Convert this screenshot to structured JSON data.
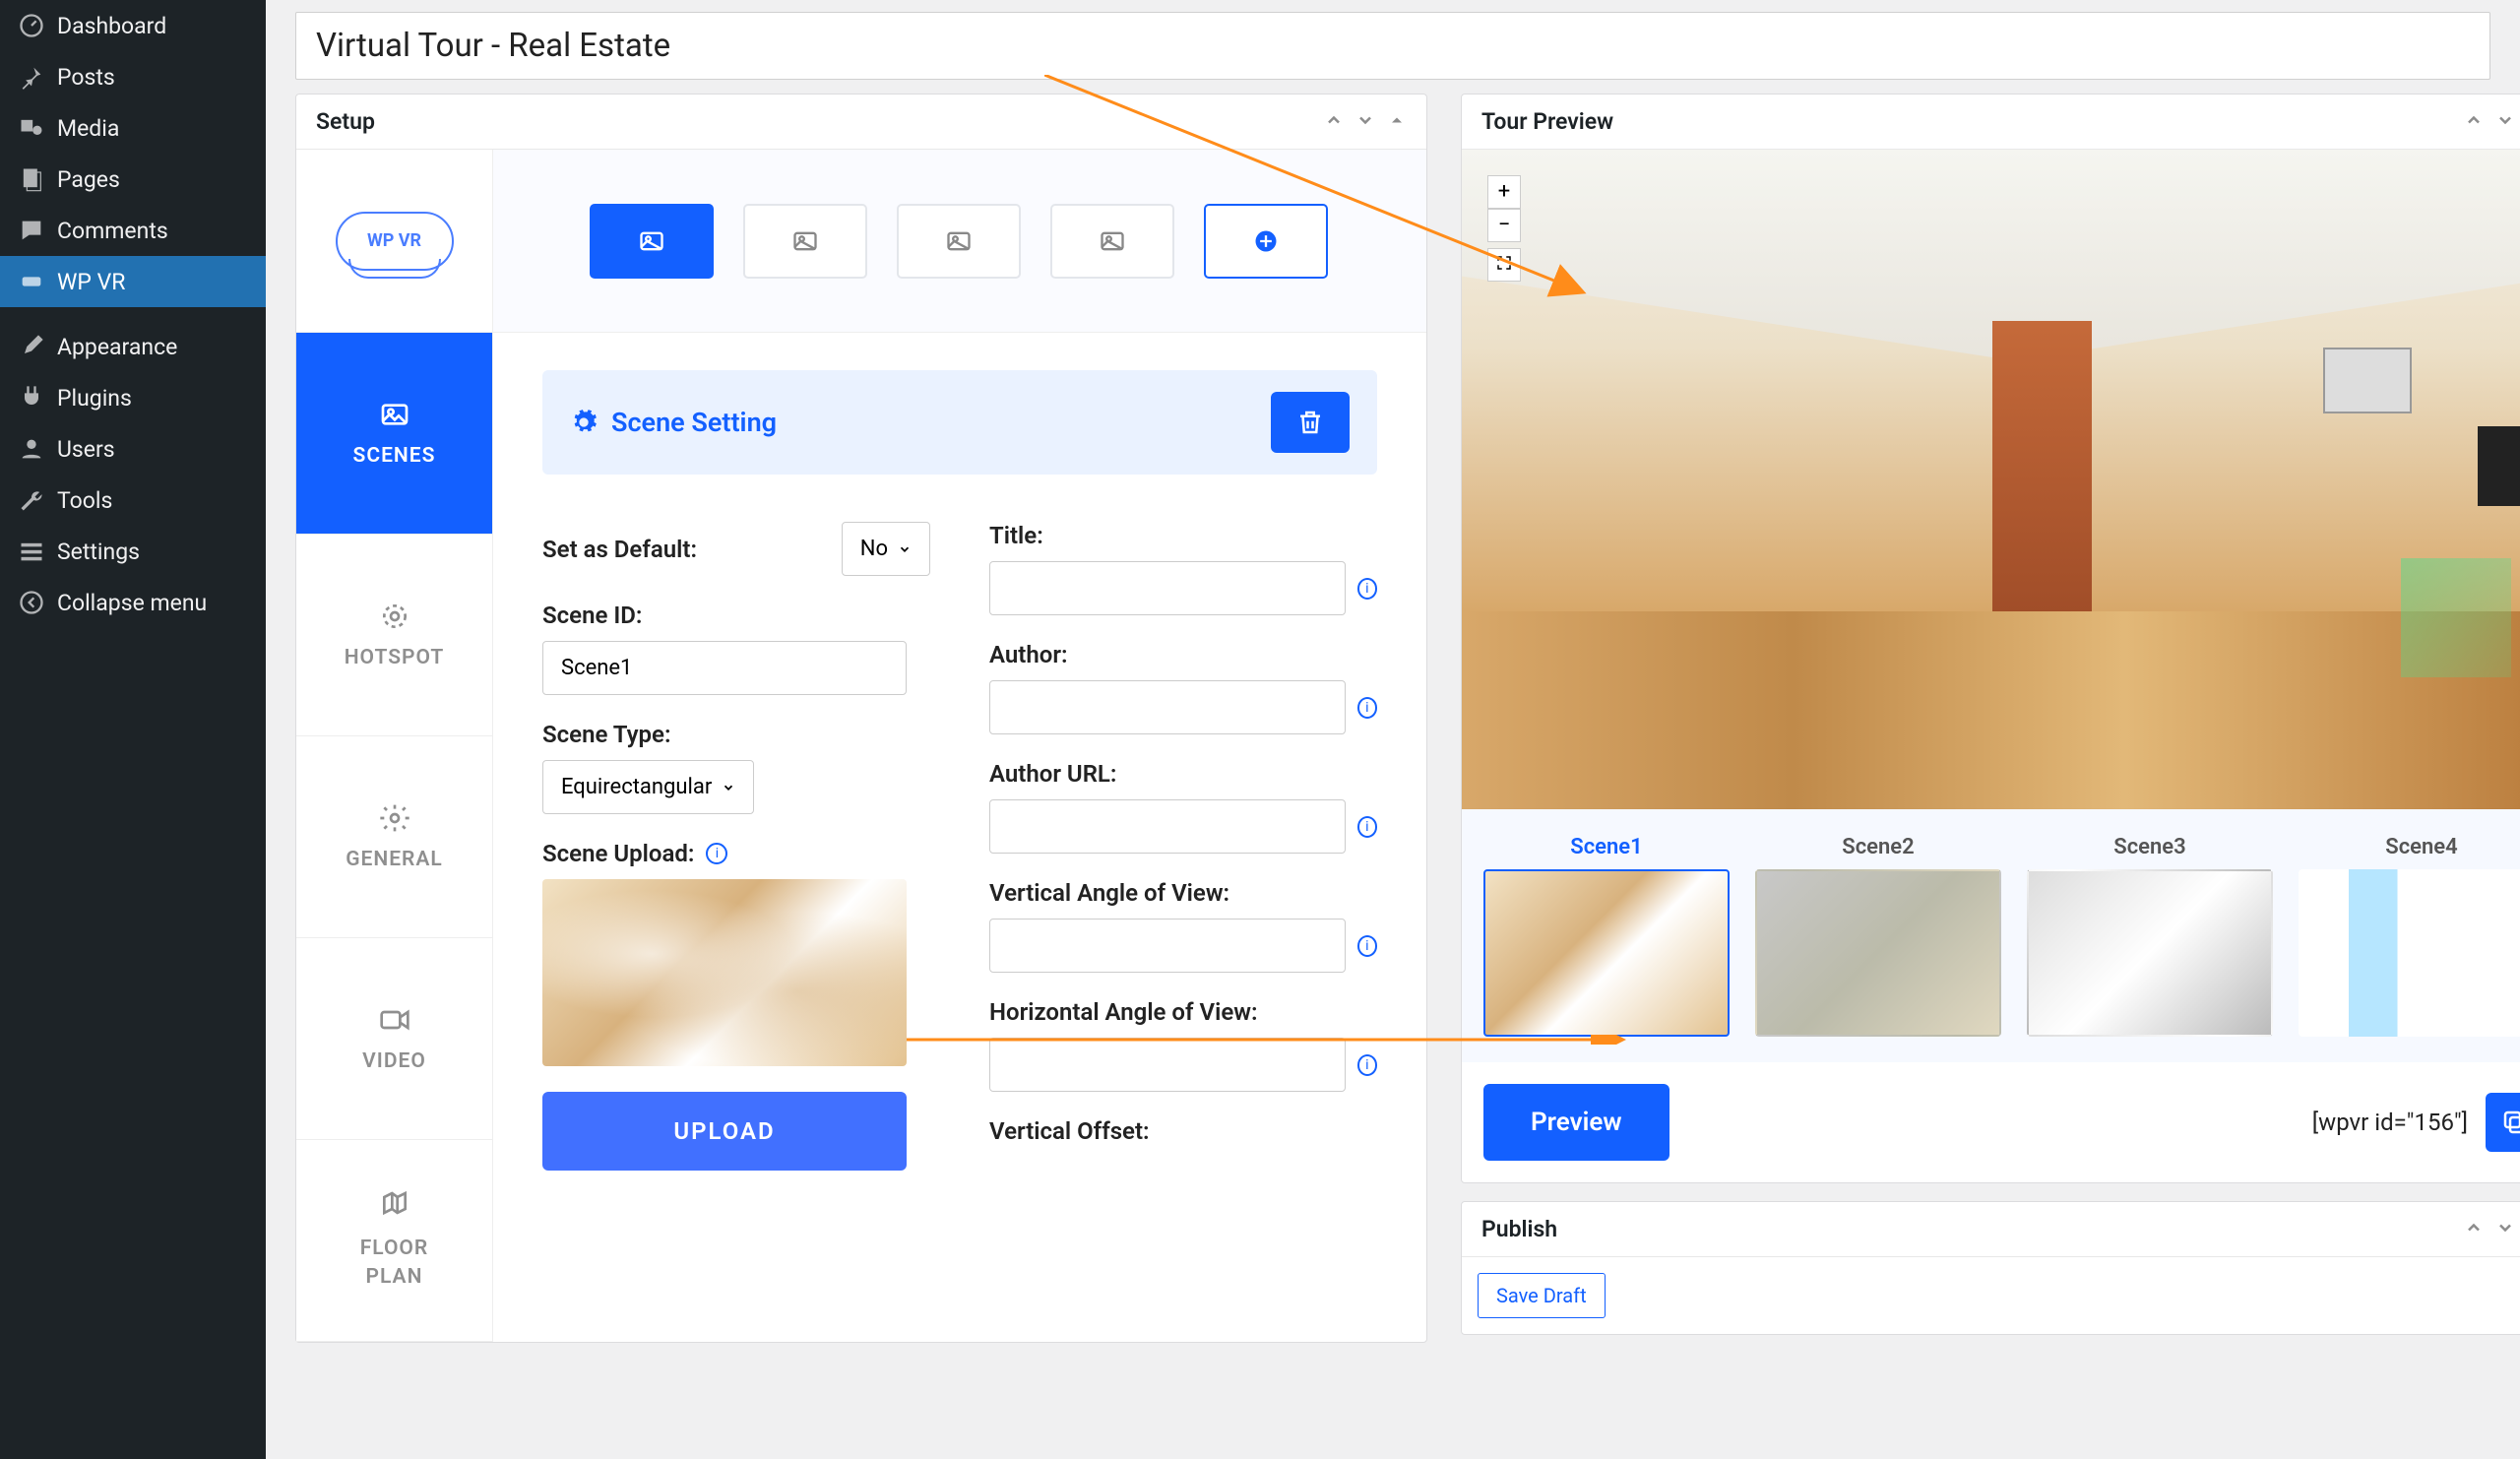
{
  "sidebar": {
    "items": [
      {
        "label": "Dashboard",
        "icon": "dashboard"
      },
      {
        "label": "Posts",
        "icon": "pin"
      },
      {
        "label": "Media",
        "icon": "media"
      },
      {
        "label": "Pages",
        "icon": "pages"
      },
      {
        "label": "Comments",
        "icon": "comments"
      },
      {
        "label": "WP VR",
        "icon": "wpvr"
      },
      {
        "label": "Appearance",
        "icon": "brush"
      },
      {
        "label": "Plugins",
        "icon": "plugin"
      },
      {
        "label": "Users",
        "icon": "users"
      },
      {
        "label": "Tools",
        "icon": "wrench"
      },
      {
        "label": "Settings",
        "icon": "settings"
      },
      {
        "label": "Collapse menu",
        "icon": "collapse"
      }
    ]
  },
  "title_input": "Virtual Tour - Real Estate",
  "panels": {
    "setup_title": "Setup",
    "preview_title": "Tour Preview",
    "publish_title": "Publish"
  },
  "tabs": [
    {
      "label": "SCENES"
    },
    {
      "label": "HOTSPOT"
    },
    {
      "label": "GENERAL"
    },
    {
      "label": "VIDEO"
    },
    {
      "label": "FLOOR PLAN"
    }
  ],
  "scene_heading": "Scene Setting",
  "form": {
    "set_default_label": "Set as Default:",
    "set_default_value": "No",
    "scene_id_label": "Scene ID:",
    "scene_id_value": "Scene1",
    "scene_type_label": "Scene Type:",
    "scene_type_value": "Equirectangular",
    "scene_upload_label": "Scene Upload:",
    "upload_btn": "UPLOAD",
    "title_label": "Title:",
    "author_label": "Author:",
    "author_url_label": "Author URL:",
    "vaov_label": "Vertical Angle of View:",
    "haov_label": "Horizontal Angle of View:",
    "voffset_label": "Vertical Offset:"
  },
  "scene_thumbs": [
    "Scene1",
    "Scene2",
    "Scene3",
    "Scene4"
  ],
  "preview_btn": "Preview",
  "shortcode": "[wpvr id=\"156\"]",
  "zoom": {
    "in": "+",
    "out": "−"
  },
  "publish": {
    "save_draft": "Save Draft"
  },
  "logo_text": "WP VR"
}
